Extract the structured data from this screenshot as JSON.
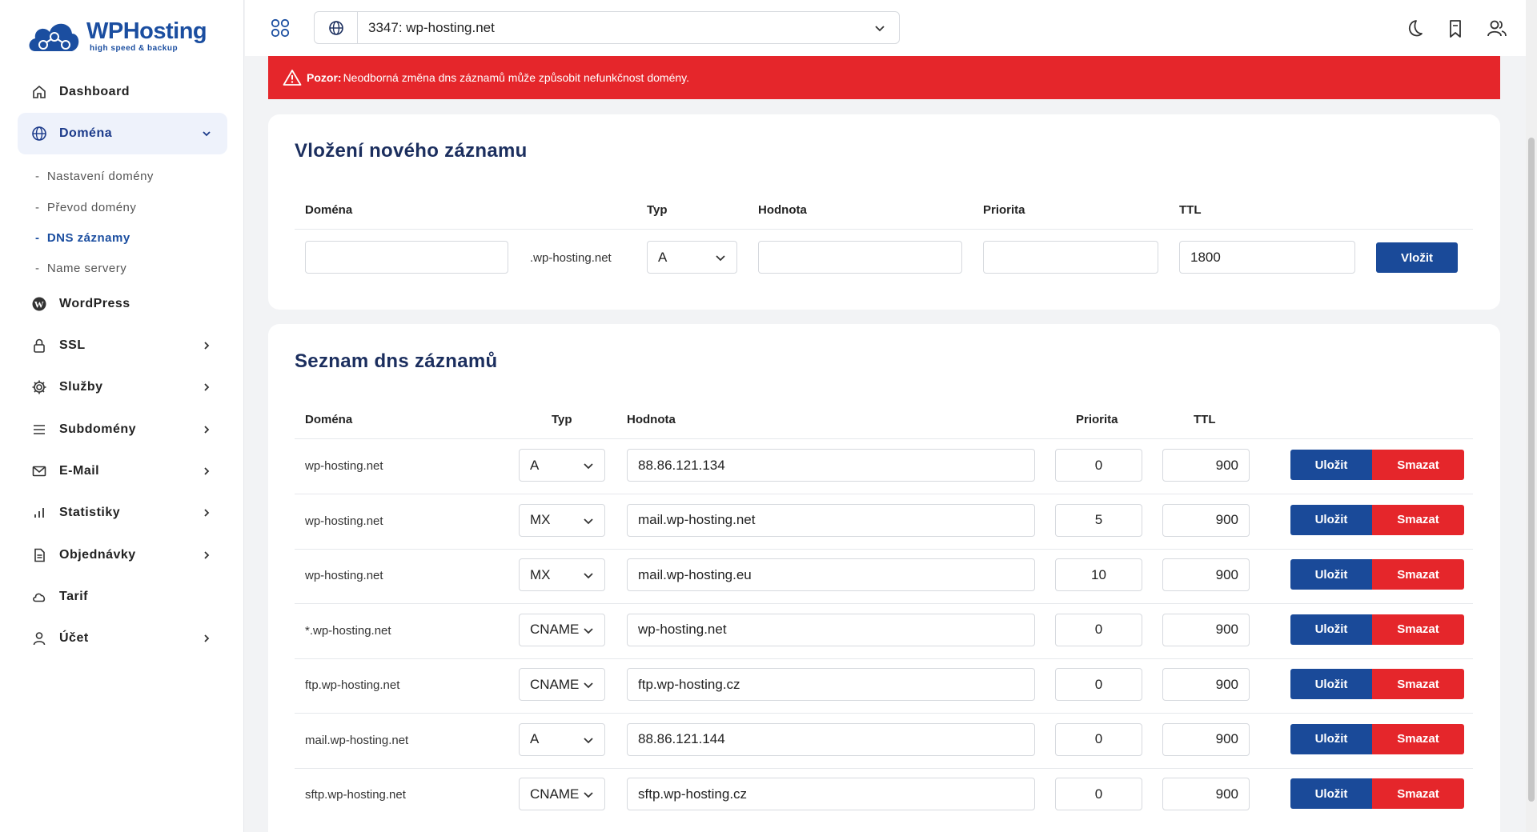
{
  "brand": {
    "title": "WPHosting",
    "subtitle": "high speed & backup"
  },
  "sidebar": {
    "items": [
      {
        "label": "Dashboard",
        "icon": "home-icon"
      },
      {
        "label": "Doména",
        "icon": "globe-icon",
        "expanded": true
      },
      {
        "label": "WordPress",
        "icon": "wordpress-icon"
      },
      {
        "label": "SSL",
        "icon": "lock-icon"
      },
      {
        "label": "Služby",
        "icon": "gear-icon"
      },
      {
        "label": "Subdomény",
        "icon": "menu-icon"
      },
      {
        "label": "E-Mail",
        "icon": "mail-icon"
      },
      {
        "label": "Statistiky",
        "icon": "bar-chart-icon"
      },
      {
        "label": "Objednávky",
        "icon": "document-icon"
      },
      {
        "label": "Tarif",
        "icon": "cloud-icon"
      },
      {
        "label": "Účet",
        "icon": "user-icon"
      }
    ],
    "domain_sub": [
      {
        "label": "Nastavení domény"
      },
      {
        "label": "Převod domény"
      },
      {
        "label": "DNS záznamy",
        "active": true
      },
      {
        "label": "Name servery"
      }
    ]
  },
  "topbar": {
    "domain_value": "3347: wp-hosting.net"
  },
  "alert": {
    "bold": "Pozor:",
    "text": "Neodborná změna dns záznamů může způsobit nefunkčnost domény."
  },
  "new_record": {
    "title": "Vložení nového záznamu",
    "headers": {
      "domain": "Doména",
      "type": "Typ",
      "value": "Hodnota",
      "priority": "Priorita",
      "ttl": "TTL"
    },
    "suffix": ".wp-hosting.net",
    "type": "A",
    "ttl": "1800",
    "submit": "Vložit"
  },
  "records": {
    "title": "Seznam dns záznamů",
    "headers": {
      "domain": "Doména",
      "type": "Typ",
      "value": "Hodnota",
      "priority": "Priorita",
      "ttl": "TTL"
    },
    "save_label": "Uložit",
    "delete_label": "Smazat",
    "rows": [
      {
        "domain": "wp-hosting.net",
        "type": "A",
        "value": "88.86.121.134",
        "priority": "0",
        "ttl": "900"
      },
      {
        "domain": "wp-hosting.net",
        "type": "MX",
        "value": "mail.wp-hosting.net",
        "priority": "5",
        "ttl": "900"
      },
      {
        "domain": "wp-hosting.net",
        "type": "MX",
        "value": "mail.wp-hosting.eu",
        "priority": "10",
        "ttl": "900"
      },
      {
        "domain": "*.wp-hosting.net",
        "type": "CNAME",
        "value": "wp-hosting.net",
        "priority": "0",
        "ttl": "900"
      },
      {
        "domain": "ftp.wp-hosting.net",
        "type": "CNAME",
        "value": "ftp.wp-hosting.cz",
        "priority": "0",
        "ttl": "900"
      },
      {
        "domain": "mail.wp-hosting.net",
        "type": "A",
        "value": "88.86.121.144",
        "priority": "0",
        "ttl": "900"
      },
      {
        "domain": "sftp.wp-hosting.net",
        "type": "CNAME",
        "value": "sftp.wp-hosting.cz",
        "priority": "0",
        "ttl": "900"
      }
    ]
  },
  "colors": {
    "primary": "#1a4a99",
    "danger": "#e5262b",
    "title": "#1b2e5e"
  }
}
